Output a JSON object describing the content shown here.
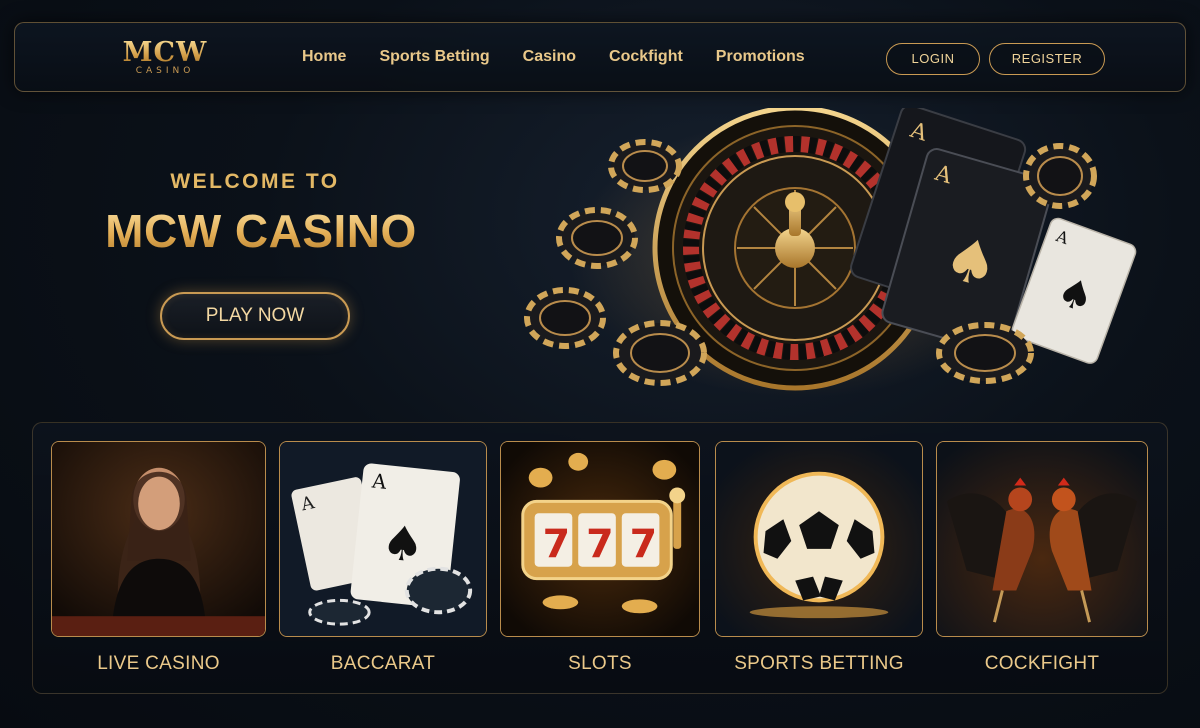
{
  "brand": {
    "name": "MCW",
    "sub": "CASINO"
  },
  "nav": {
    "links": [
      "Home",
      "Sports Betting",
      "Casino",
      "Cockfight",
      "Promotions"
    ],
    "login_label": "LOGIN",
    "register_label": "REGISTER"
  },
  "hero": {
    "kicker": "WELCOME TO",
    "title": "MCW CASINO",
    "cta_label": "PLAY NOW"
  },
  "categories": [
    {
      "label": "LIVE CASINO",
      "icon": "live-dealer-image"
    },
    {
      "label": "BACCARAT",
      "icon": "cards-chips-image"
    },
    {
      "label": "SLOTS",
      "icon": "slot-machine-777-image"
    },
    {
      "label": "SPORTS BETTING",
      "icon": "soccer-ball-image"
    },
    {
      "label": "COCKFIGHT",
      "icon": "roosters-image"
    }
  ],
  "colors": {
    "gold": "#e3b45e",
    "gold_border": "#c99a53",
    "background": "#0b1119"
  }
}
